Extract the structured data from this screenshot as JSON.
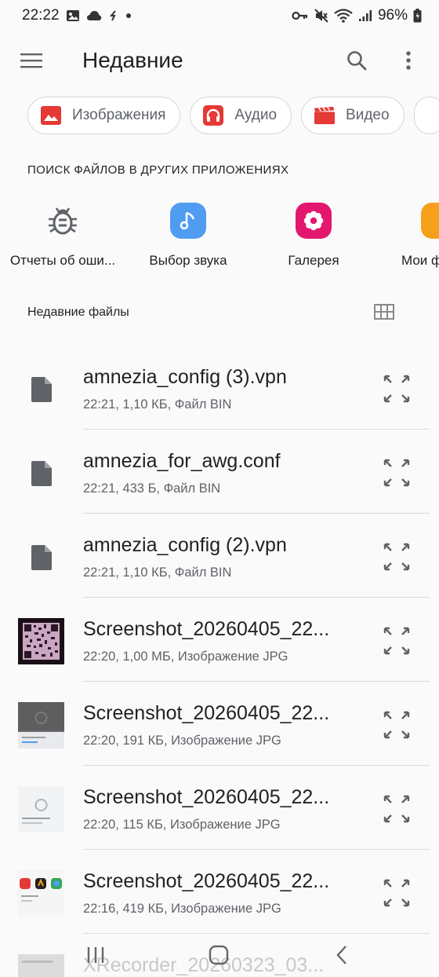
{
  "status_bar": {
    "time": "22:22",
    "battery": "96%",
    "icons": [
      "gallery-icon",
      "cloud-icon",
      "sync-icon",
      "dot-icon",
      "key-icon",
      "mute-icon",
      "wifi-icon",
      "signal-icon",
      "battery-icon"
    ]
  },
  "appbar": {
    "title": "Недавние",
    "icons": [
      "menu-icon",
      "search-icon",
      "more-vert-icon"
    ]
  },
  "chips": [
    {
      "label": "Изображения",
      "icon": "image-icon",
      "color": "#e53935"
    },
    {
      "label": "Аудио",
      "icon": "headphones-icon",
      "color": "#e53935"
    },
    {
      "label": "Видео",
      "icon": "clapperboard-icon",
      "color": "#e53935"
    }
  ],
  "apps_section": {
    "title": "ПОИСК ФАЙЛОВ В ДРУГИХ ПРИЛОЖЕНИЯХ",
    "apps": [
      {
        "label": "Отчеты об оши...",
        "icon": "bug-icon",
        "color": "#5f6368"
      },
      {
        "label": "Выбор звука",
        "icon": "music-note-icon",
        "color": "#4f9cf1"
      },
      {
        "label": "Галерея",
        "icon": "flower-icon",
        "color": "#e4176f"
      },
      {
        "label": "Мои ф",
        "icon": "folder-icon",
        "color": "#f5a11c"
      }
    ]
  },
  "recent": {
    "title": "Недавние файлы",
    "grid_icon": "grid-view-icon",
    "files": [
      {
        "name": "amnezia_config (3).vpn",
        "meta": "22:21, 1,10 КБ, Файл BIN",
        "thumb": "file-icon"
      },
      {
        "name": "amnezia_for_awg.conf",
        "meta": "22:21, 433 Б, Файл BIN",
        "thumb": "file-icon"
      },
      {
        "name": "amnezia_config (2).vpn",
        "meta": "22:21, 1,10 КБ, Файл BIN",
        "thumb": "file-icon"
      },
      {
        "name": "Screenshot_20260405_22...",
        "meta": "22:20, 1,00 МБ, Изображение JPG",
        "thumb": "qr-thumbnail"
      },
      {
        "name": "Screenshot_20260405_22...",
        "meta": "22:20, 191 КБ, Изображение JPG",
        "thumb": "dark-screenshot-thumbnail"
      },
      {
        "name": "Screenshot_20260405_22...",
        "meta": "22:20, 115 КБ, Изображение JPG",
        "thumb": "light-screenshot-thumbnail"
      },
      {
        "name": "Screenshot_20260405_22...",
        "meta": "22:16, 419 КБ, Изображение JPG",
        "thumb": "apps-screenshot-thumbnail"
      }
    ],
    "partial_file": {
      "name": "XRecorder_20260323_03..."
    }
  },
  "navbar": {
    "icons": [
      "recents-icon",
      "home-icon",
      "back-icon"
    ]
  }
}
